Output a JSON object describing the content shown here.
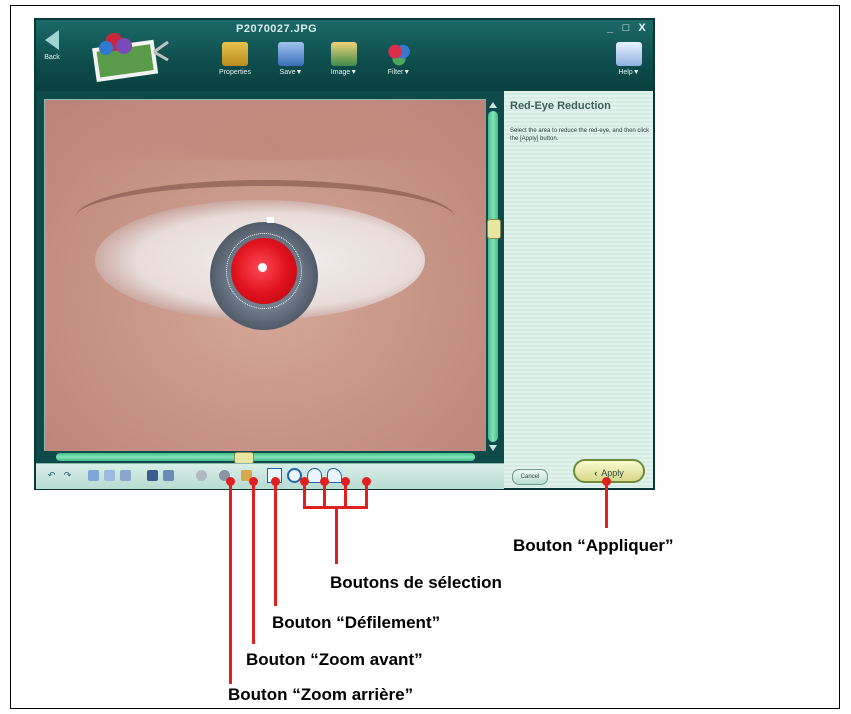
{
  "window": {
    "title": "P2070027.JPG",
    "controls": [
      "_",
      "□",
      "X"
    ]
  },
  "toolbar": {
    "back_label": "Back",
    "properties_label": "Properties",
    "save_label": "Save▼",
    "image_label": "Image▼",
    "filter_label": "Filter▼",
    "help_label": "Help▼"
  },
  "panel": {
    "title": "Red-Eye Reduction",
    "instructions": "Select the area to reduce the red-eye, and then click the [Apply] button.",
    "cancel_label": "Cancel",
    "apply_label": "Apply"
  },
  "callouts": {
    "apply": "Bouton “Appliquer”",
    "selection": "Boutons de sélection",
    "scroll": "Bouton “Défilement”",
    "zoom_in": "Bouton “Zoom avant”",
    "zoom_out": "Bouton “Zoom arrière”"
  },
  "colors": {
    "callout_line": "#e0201e",
    "toolbar_bg": "#0e4a4a",
    "panel_bg": "#e2f3ec"
  }
}
